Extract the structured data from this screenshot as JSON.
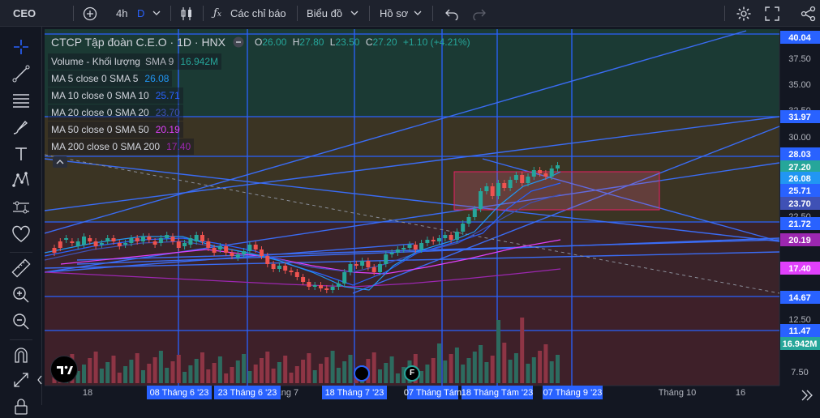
{
  "topbar": {
    "symbol": "CEO",
    "interval": "4h",
    "interval_alt": "D",
    "indicators_label": "Các chỉ báo",
    "chart_label": "Biểu đồ",
    "profile_label": "Hồ sơ"
  },
  "legend": {
    "title": "CTCP Tập đoàn C.E.O · 1D · HNX",
    "ohlc": {
      "o_label": "O",
      "o": "26.00",
      "h_label": "H",
      "h": "27.80",
      "l_label": "L",
      "l": "23.50",
      "c_label": "C",
      "c": "27.20",
      "change": "+1.10 (+4.21%)"
    },
    "rows": [
      {
        "label": "Volume - Khối lượng",
        "sub": "SMA 9",
        "value": "16.942M",
        "color": "#26a69a"
      },
      {
        "label": "MA 5 close 0 SMA 5",
        "sub": "",
        "value": "26.08",
        "color": "#2196f3"
      },
      {
        "label": "MA 10 close 0 SMA 10",
        "sub": "",
        "value": "25.71",
        "color": "#2962ff"
      },
      {
        "label": "MA 20 close 0 SMA 20",
        "sub": "",
        "value": "23.70",
        "color": "#3f51b5"
      },
      {
        "label": "MA 50 close 0 SMA 50",
        "sub": "",
        "value": "20.19",
        "color": "#e040fb"
      },
      {
        "label": "MA 200 close 0 SMA 200",
        "sub": "",
        "value": "17.40",
        "color": "#9c27b0"
      }
    ]
  },
  "price_axis": {
    "ticks": [
      "37.50",
      "35.00",
      "32.50",
      "30.00",
      "22.50",
      "12.50",
      "7.50"
    ],
    "badges": [
      {
        "value": "40.04",
        "color": "#2962ff"
      },
      {
        "value": "31.97",
        "color": "#2962ff"
      },
      {
        "value": "28.03",
        "color": "#2962ff"
      },
      {
        "value": "27.20",
        "color": "#26a69a"
      },
      {
        "value": "26.08",
        "color": "#2196f3"
      },
      {
        "value": "25.71",
        "color": "#2962ff"
      },
      {
        "value": "23.70",
        "color": "#3f51b5"
      },
      {
        "value": "21.72",
        "color": "#2962ff"
      },
      {
        "value": "20.19",
        "color": "#9c27b0"
      },
      {
        "value": "17.40",
        "color": "#e040fb"
      },
      {
        "value": "14.67",
        "color": "#2962ff"
      },
      {
        "value": "11.47",
        "color": "#2962ff"
      },
      {
        "value": "16.942M",
        "color": "#26a69a"
      }
    ]
  },
  "time_axis": {
    "labels": [
      "18",
      "Tháng 7",
      "Tháng 10",
      "16"
    ],
    "date_badges": [
      "08 Tháng 6 '23",
      "23 Tháng 6 '23",
      "18 Tháng 7 '23",
      "07 Tháng Tám",
      "18 Tháng Tám '23",
      "07 Tháng 9 '23"
    ]
  },
  "events": [
    "F"
  ]
}
